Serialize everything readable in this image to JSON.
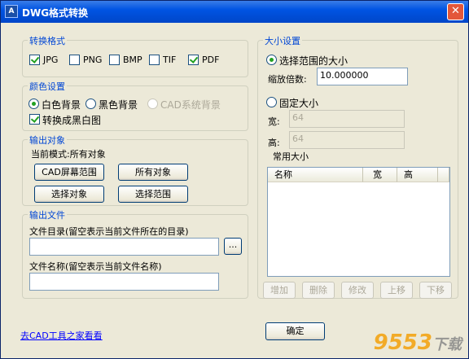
{
  "window": {
    "title": "DWG格式转换",
    "close_symbol": "✕",
    "icon_text": "A"
  },
  "format_group": {
    "title": "转换格式",
    "options": [
      {
        "label": "JPG",
        "checked": true
      },
      {
        "label": "PNG",
        "checked": false
      },
      {
        "label": "BMP",
        "checked": false
      },
      {
        "label": "TIF",
        "checked": false
      },
      {
        "label": "PDF",
        "checked": true
      }
    ]
  },
  "color_group": {
    "title": "颜色设置",
    "white_bg": "白色背景",
    "black_bg": "黑色背景",
    "cad_bg": "CAD系统背景",
    "convert_bw": "转换成黑白图"
  },
  "output_object_group": {
    "title": "输出对象",
    "current_mode": "当前模式:所有对象",
    "btn_cad_screen": "CAD屏幕范围",
    "btn_all_objects": "所有对象",
    "btn_select_objects": "选择对象",
    "btn_select_range": "选择范围"
  },
  "output_file_group": {
    "title": "输出文件",
    "dir_label": "文件目录(留空表示当前文件所在的目录)",
    "dir_value": "",
    "browse_label": "...",
    "name_label": "文件名称(留空表示当前文件名称)",
    "name_value": ""
  },
  "size_group": {
    "title": "大小设置",
    "select_range_size": "选择范围的大小",
    "scale_label": "缩放倍数:",
    "scale_value": "10.000000",
    "fixed_size": "固定大小",
    "width_label": "宽:",
    "width_value": "64",
    "height_label": "高:",
    "height_value": "64",
    "common_sizes": "常用大小",
    "columns": [
      "名称",
      "宽",
      "高"
    ],
    "btn_add": "增加",
    "btn_delete": "删除",
    "btn_modify": "修改",
    "btn_up": "上移",
    "btn_down": "下移"
  },
  "footer": {
    "link": "去CAD工具之家看看",
    "ok": "确定"
  },
  "watermark": {
    "brand": "9553",
    "suffix": "下载"
  }
}
